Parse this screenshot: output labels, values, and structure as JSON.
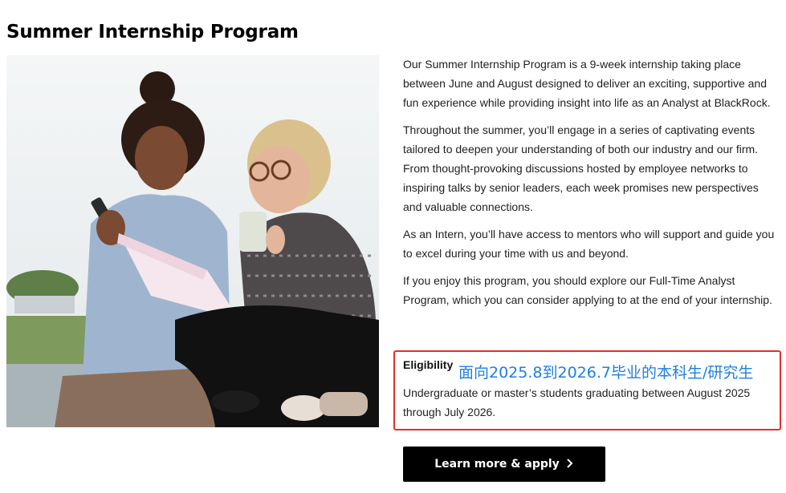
{
  "page": {
    "title": "Summer Internship Program"
  },
  "content": {
    "paragraphs": [
      "Our Summer Internship Program is a 9-week internship taking place between June and August designed to deliver an exciting, supportive and fun experience while providing insight into life as an Analyst at BlackRock.",
      "Throughout the summer, you’ll engage in a series of captivating events tailored to deepen your understanding of both our industry and our firm. From thought-provoking discussions hosted by employee networks to inspiring talks by senior leaders, each week promises new perspectives and valuable connections.",
      "As an Intern, you’ll have access to mentors who will support and guide you to excel during your time with us and beyond.",
      "If you enjoy this program, you should explore our Full-Time Analyst Program, which you can consider applying to at the end of your internship."
    ]
  },
  "eligibility": {
    "label": "Eligibility",
    "note": "面向2025.8到2026.7毕业的本科生/研究生",
    "text": "Undergraduate or master’s students graduating between August 2025 through July 2026."
  },
  "cta": {
    "label": "Learn more & apply",
    "icon": "chevron-right-icon"
  },
  "colors": {
    "highlight_border": "#e0322b",
    "annotation_text": "#1f7fe0",
    "button_bg": "#000000"
  }
}
